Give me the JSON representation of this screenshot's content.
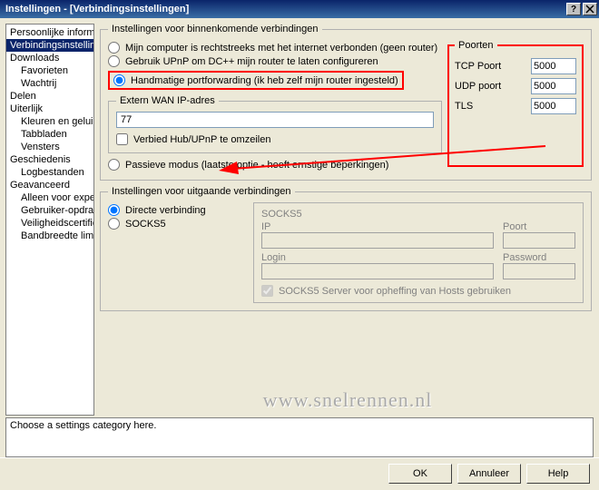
{
  "window": {
    "title": "Instellingen - [Verbindingsinstellingen]"
  },
  "tree": {
    "items": [
      {
        "label": "Persoonlijke informatie",
        "indent": 0
      },
      {
        "label": "Verbindingsinstellingen",
        "indent": 0,
        "selected": true
      },
      {
        "label": "Downloads",
        "indent": 0
      },
      {
        "label": "Favorieten",
        "indent": 1
      },
      {
        "label": "Wachtrij",
        "indent": 1
      },
      {
        "label": "Delen",
        "indent": 0
      },
      {
        "label": "Uiterlijk",
        "indent": 0
      },
      {
        "label": "Kleuren en geluid",
        "indent": 1
      },
      {
        "label": "Tabbladen",
        "indent": 1
      },
      {
        "label": "Vensters",
        "indent": 1
      },
      {
        "label": "Geschiedenis",
        "indent": 0
      },
      {
        "label": "Logbestanden",
        "indent": 1
      },
      {
        "label": "Geavanceerd",
        "indent": 0
      },
      {
        "label": "Alleen voor experts",
        "indent": 1
      },
      {
        "label": "Gebruiker-opdrachten",
        "indent": 1
      },
      {
        "label": "Veiligheidscertificaten",
        "indent": 1
      },
      {
        "label": "Bandbreedte limiteren",
        "indent": 1
      }
    ]
  },
  "incoming": {
    "legend": "Instellingen voor binnenkomende verbindingen",
    "opt_direct": "Mijn computer is rechtstreeks met het internet verbonden (geen router)",
    "opt_upnp": "Gebruik UPnP om DC++ mijn router te laten configureren",
    "opt_manual": "Handmatige portforwarding (ik heb zelf mijn router ingesteld)",
    "opt_passive": "Passieve modus (laatste optie - heeft ernstige beperkingen)",
    "wan_legend": "Extern WAN IP-adres",
    "wan_value": "77",
    "nohub": "Verbied Hub/UPnP te omzeilen"
  },
  "ports": {
    "legend": "Poorten",
    "tcp_label": "TCP Poort",
    "tcp_value": "5000",
    "udp_label": "UDP poort",
    "udp_value": "5000",
    "tls_label": "TLS",
    "tls_value": "5000"
  },
  "outgoing": {
    "legend": "Instellingen voor uitgaande verbindingen",
    "opt_direct": "Directe verbinding",
    "opt_socks": "SOCKS5",
    "socks_title": "SOCKS5",
    "ip": "IP",
    "port": "Poort",
    "login": "Login",
    "password": "Password",
    "resolve": "SOCKS5 Server voor opheffing van Hosts gebruiken"
  },
  "hint": "Choose a settings category here.",
  "buttons": {
    "ok": "OK",
    "cancel": "Annuleer",
    "help": "Help"
  },
  "watermark": "www.snelrennen.nl"
}
